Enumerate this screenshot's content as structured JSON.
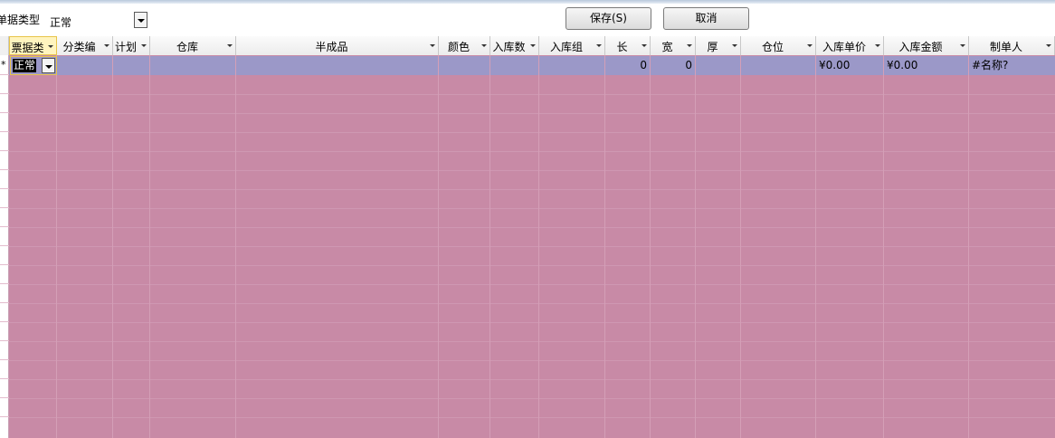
{
  "toolbar": {
    "type_label": "单据类型",
    "type_value": "正常",
    "save_label": "保存(S)",
    "cancel_label": "取消"
  },
  "grid": {
    "columns": [
      "票据类",
      "分类编",
      "计划",
      "仓库",
      "半成品",
      "颜色",
      "入库数",
      "入库组",
      "长",
      "宽",
      "厚",
      "仓位",
      "入库单价",
      "入库金额",
      "制单人"
    ],
    "new_row": {
      "ticket_type": "正常",
      "length": "0",
      "width": "0",
      "unit_price": "¥0.00",
      "amount": "¥0.00",
      "creator": "#名称?"
    },
    "new_row_marker": "*"
  },
  "colors": {
    "grid_body": "#c88aa6",
    "new_row": "#9b98c8",
    "active_header": "#fff4bf"
  }
}
